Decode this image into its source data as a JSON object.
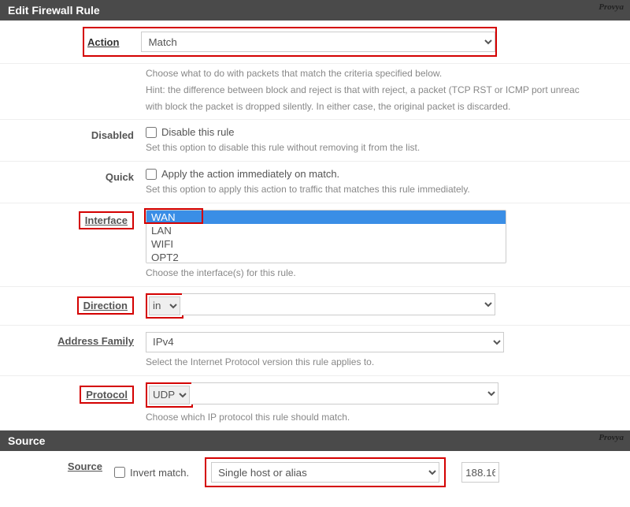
{
  "watermark": "Provya",
  "editHeader": "Edit Firewall Rule",
  "action": {
    "label": "Action",
    "value": "Match",
    "help1": "Choose what to do with packets that match the criteria specified below.",
    "help2": "Hint: the difference between block and reject is that with reject, a packet (TCP RST or ICMP port unreac",
    "help3": "with block the packet is dropped silently. In either case, the original packet is discarded."
  },
  "disabled": {
    "label": "Disabled",
    "chk": "Disable this rule",
    "help": "Set this option to disable this rule without removing it from the list."
  },
  "quick": {
    "label": "Quick",
    "chk": "Apply the action immediately on match.",
    "help": "Set this option to apply this action to traffic that matches this rule immediately."
  },
  "interface": {
    "label": "Interface",
    "options": [
      "WAN",
      "LAN",
      "WIFI",
      "OPT2"
    ],
    "help": "Choose the interface(s) for this rule."
  },
  "direction": {
    "label": "Direction",
    "value": "in"
  },
  "addressFamily": {
    "label": "Address Family",
    "value": "IPv4",
    "help": "Select the Internet Protocol version this rule applies to."
  },
  "protocol": {
    "label": "Protocol",
    "value": "UDP",
    "help": "Choose which IP protocol this rule should match."
  },
  "sourceHeader": "Source",
  "source": {
    "label": "Source",
    "invert": "Invert match.",
    "type": "Single host or alias",
    "ip": "188.16"
  }
}
